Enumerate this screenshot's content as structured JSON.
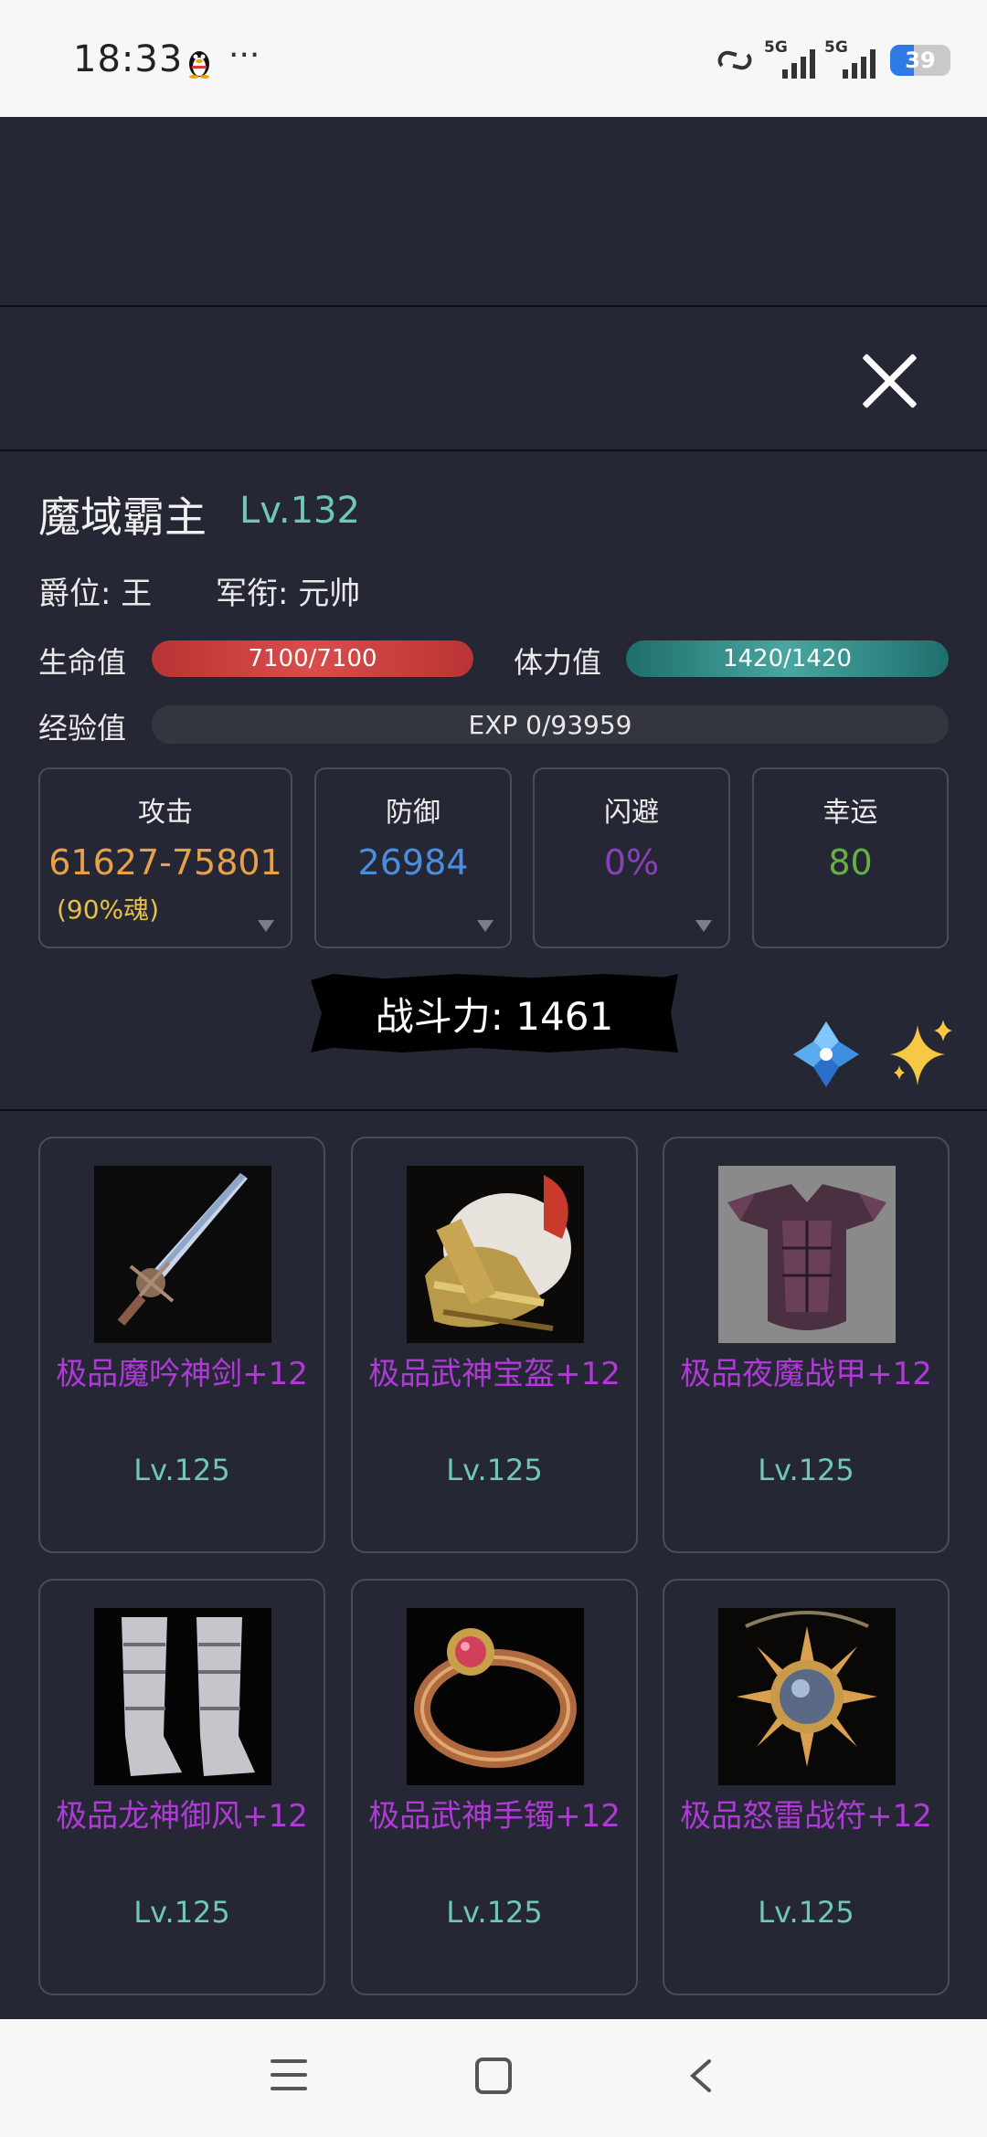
{
  "status_bar": {
    "time": "18:33",
    "dots": "···",
    "net1": "5G",
    "net2": "5G",
    "battery": "39"
  },
  "character": {
    "name": "魔域霸主",
    "level": "Lv.132",
    "rank": "爵位: 王",
    "military": "军衔: 元帅"
  },
  "bars": {
    "hp_label": "生命值",
    "hp_value": "7100/7100",
    "sp_label": "体力值",
    "sp_value": "1420/1420",
    "exp_label": "经验值",
    "exp_value": "EXP 0/93959"
  },
  "stats": [
    {
      "title": "攻击",
      "value": "61627-75801",
      "extra": "(90%魂)",
      "color": "#e8a04a"
    },
    {
      "title": "防御",
      "value": "26984",
      "color": "#4b8de0"
    },
    {
      "title": "闪避",
      "value": "0%",
      "color": "#8b3fb8"
    },
    {
      "title": "幸运",
      "value": "80",
      "color": "#67b045"
    }
  ],
  "power": "战斗力: 1461",
  "equipment": [
    {
      "name": "极品魔吟神剑+12",
      "level": "Lv.125",
      "icon": "sword-icon"
    },
    {
      "name": "极品武神宝盔+12",
      "level": "Lv.125",
      "icon": "helmet-icon"
    },
    {
      "name": "极品夜魔战甲+12",
      "level": "Lv.125",
      "icon": "armor-icon"
    },
    {
      "name": "极品龙神御风+12",
      "level": "Lv.125",
      "icon": "boots-icon"
    },
    {
      "name": "极品武神手镯+12",
      "level": "Lv.125",
      "icon": "bracelet-icon"
    },
    {
      "name": "极品怒雷战符+12",
      "level": "Lv.125",
      "icon": "talisman-icon"
    }
  ]
}
